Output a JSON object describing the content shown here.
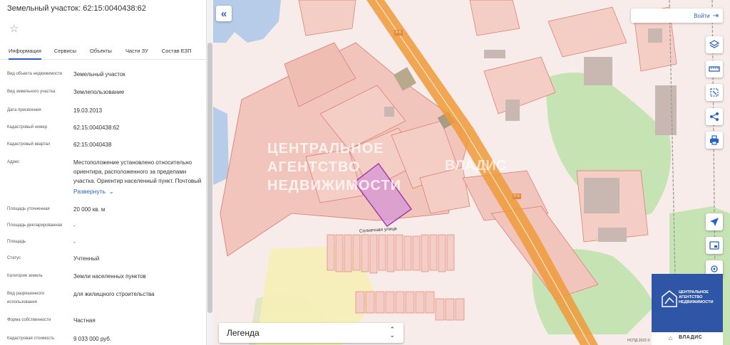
{
  "panel": {
    "title": "Земельный участок: 62:15:0040438:62",
    "tabs": [
      "Информация",
      "Сервисы",
      "Объекты",
      "Части ЗУ",
      "Состав ЕЗП"
    ],
    "rows": [
      {
        "label": "Вид объекта недвижимости",
        "value": "Земельный участок"
      },
      {
        "label": "Вид земельного участка",
        "value": "Землепользование"
      },
      {
        "label": "Дата присвоения",
        "value": "19.03.2013"
      },
      {
        "label": "Кадастровый номер",
        "value": "62:15:0040438:62"
      },
      {
        "label": "Кадастровый квартал",
        "value": "62:15:0040438"
      },
      {
        "label": "Адрес",
        "value": "Местоположение установлено относительно ориентира, расположенного за пределами участка. Ориентир населенный пункт. Почтовый"
      },
      {
        "label": "Площадь уточненная",
        "value": "20 000 кв. м"
      },
      {
        "label": "Площадь декларированная",
        "value": "-"
      },
      {
        "label": "Площадь",
        "value": "-"
      },
      {
        "label": "Статус",
        "value": "Учтенный"
      },
      {
        "label": "Категория земель",
        "value": "Земли населенных пунктов"
      },
      {
        "label": "Вид разрешенного использования",
        "value": "для жилищного строительства"
      },
      {
        "label": "Форма собственности",
        "value": "Частная"
      },
      {
        "label": "Кадастровая стоимость",
        "value": "9 033 000 руб."
      }
    ],
    "expand_label": "Развернуть"
  },
  "map": {
    "login_label": "Войти",
    "legend_label": "Легенда",
    "street_label": "Солнечная улица",
    "road_badges": [
      "Р-5",
      "Р-5"
    ],
    "watermark_line1": "ЦЕНТРАЛЬНОЕ",
    "watermark_line2": "АГЕНТСТВО",
    "watermark_line3": "НЕДВИЖИМОСТИ",
    "watermark_right": "ВЛАДИС",
    "copyright": "НСПД 2023 ©",
    "tools": [
      "layers-icon",
      "ruler-icon",
      "select-area-icon",
      "share-icon",
      "print-icon",
      "navigate-icon",
      "card-icon",
      "location-icon"
    ]
  },
  "brand": {
    "line1": "ЦЕНТРАЛЬНОЕ",
    "line2": "АГЕНТСТВО",
    "line3": "НЕДВИЖИМОСТИ",
    "bottom": "ВЛАДИС"
  },
  "colors": {
    "accent": "#2a5fc9",
    "parcel_fill": "#f2c5bc",
    "parcel_stroke": "#d9786a",
    "selected": "#c060c0",
    "road": "#f09a3a",
    "green": "#c6e3b4",
    "brand": "#2f56a6"
  }
}
